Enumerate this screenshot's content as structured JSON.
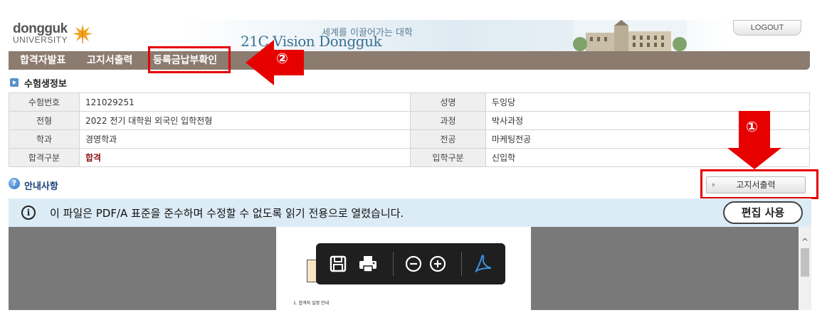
{
  "header": {
    "logo_line1": "dongguk",
    "logo_line2": "UNIVERSITY",
    "banner_sub": "세계를 이끌어가는 대학",
    "banner_main": "21C Vision Dongguk",
    "logout_label": "LOGOUT"
  },
  "nav": {
    "items": [
      {
        "label": "합격자발표"
      },
      {
        "label": "고지서출력"
      },
      {
        "label": "등록금납부확인"
      }
    ]
  },
  "annotations": {
    "marker_1": "①",
    "marker_2": "②",
    "highlight_color": "#e60000"
  },
  "applicant": {
    "section_title": "수험생정보",
    "rows": [
      {
        "l1": "수험번호",
        "v1": "121029251",
        "l2": "성명",
        "v2": "두잉당"
      },
      {
        "l1": "전형",
        "v1": "2022 전기 대학원 외국인 입학전형",
        "l2": "과정",
        "v2": "박사과정"
      },
      {
        "l1": "학과",
        "v1": "경영학과",
        "l2": "전공",
        "v2": "마케팅전공"
      },
      {
        "l1": "합격구분",
        "v1": "합격",
        "l2": "입학구분",
        "v2": "신입학"
      }
    ]
  },
  "guide": {
    "section_title": "안내사항",
    "print_button": "고지서출력"
  },
  "pdf": {
    "info_message": "이 파일은 PDF/A 표준을 준수하며 수정할 수 없도록 읽기 전용으로 열렸습니다.",
    "info_icon": "i",
    "edit_button": "편집 사용",
    "page_text": "1. 합격자 일정 안내",
    "scroll_up": "^"
  },
  "colors": {
    "nav_bg": "#8c7b6f",
    "info_bar_bg": "#dcecf6",
    "pass_text": "#8b1414"
  }
}
